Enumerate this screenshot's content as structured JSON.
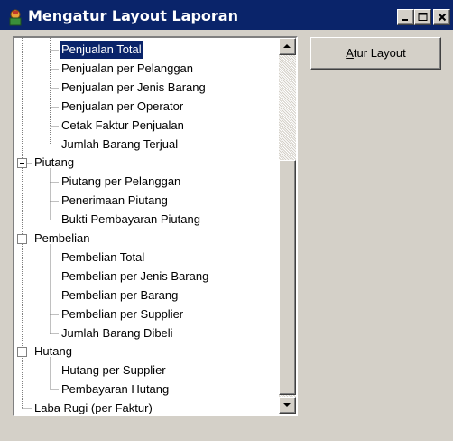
{
  "window": {
    "title": "Mengatur Layout Laporan",
    "app_icon": "report-app-icon",
    "controls": [
      "minimize-icon",
      "maximize-icon",
      "close-icon"
    ]
  },
  "button": {
    "accel": "A",
    "rest": "tur Layout"
  },
  "tree": {
    "selected_item": "Penjualan Total",
    "items": [
      {
        "label": "Penjualan Total",
        "level": 2,
        "selected": true
      },
      {
        "label": "Penjualan per Pelanggan",
        "level": 2
      },
      {
        "label": "Penjualan per Jenis Barang",
        "level": 2
      },
      {
        "label": "Penjualan per Operator",
        "level": 2
      },
      {
        "label": "Cetak Faktur Penjualan",
        "level": 2
      },
      {
        "label": "Jumlah Barang Terjual",
        "level": 2
      },
      {
        "label": "Piutang",
        "level": 1,
        "expanded": true
      },
      {
        "label": "Piutang per Pelanggan",
        "level": 2
      },
      {
        "label": "Penerimaan Piutang",
        "level": 2
      },
      {
        "label": "Bukti Pembayaran Piutang",
        "level": 2
      },
      {
        "label": "Pembelian",
        "level": 1,
        "expanded": true
      },
      {
        "label": "Pembelian Total",
        "level": 2
      },
      {
        "label": "Pembelian per Jenis Barang",
        "level": 2
      },
      {
        "label": "Pembelian per Barang",
        "level": 2
      },
      {
        "label": "Pembelian per Supplier",
        "level": 2
      },
      {
        "label": "Jumlah Barang Dibeli",
        "level": 2
      },
      {
        "label": "Hutang",
        "level": 1,
        "expanded": true
      },
      {
        "label": "Hutang per Supplier",
        "level": 2
      },
      {
        "label": "Pembayaran Hutang",
        "level": 2
      },
      {
        "label": "Laba Rugi (per Faktur)",
        "level": 1
      }
    ]
  },
  "colors": {
    "titlebar": "#0a246a",
    "selection": "#0a246a",
    "face": "#d4d0c8"
  }
}
